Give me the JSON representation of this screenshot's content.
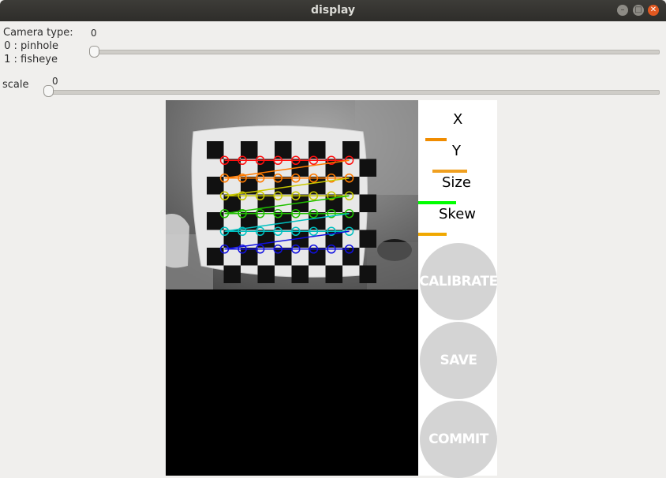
{
  "window": {
    "title": "display"
  },
  "controls": {
    "camera_type": {
      "label": "Camera type:",
      "option0": " 0 : pinhole",
      "option1": " 1 : fisheye",
      "value": "0"
    },
    "scale": {
      "label": "scale",
      "value": "0"
    }
  },
  "panel": {
    "labels": {
      "x": "X",
      "y": "Y",
      "size": "Size",
      "skew": "Skew"
    },
    "colors": {
      "x": "#f08c00",
      "y": "#f0a020",
      "size": "#00ff00",
      "skew": "#f0a800"
    },
    "buttons": {
      "calibrate": "CALIBRATE",
      "save": "SAVE",
      "commit": "COMMIT"
    }
  }
}
